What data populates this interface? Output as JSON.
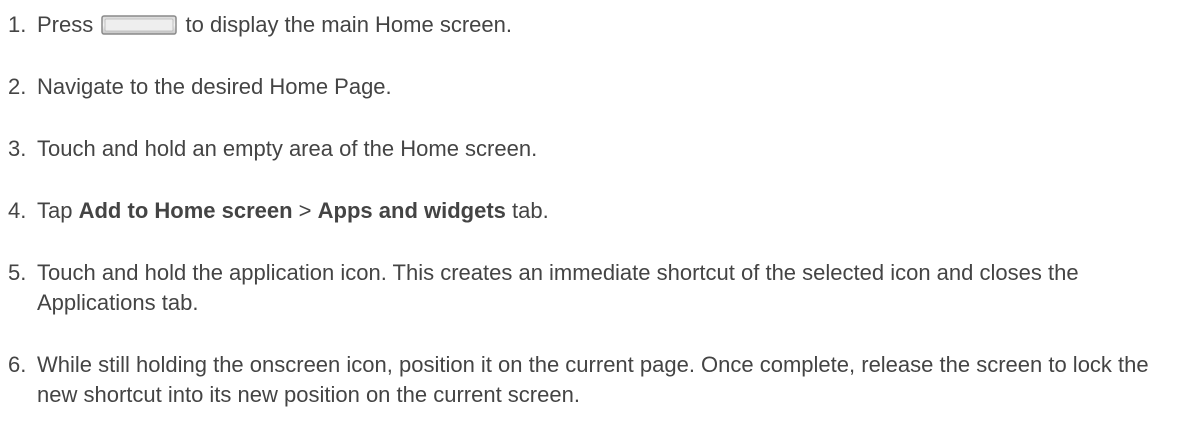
{
  "steps": [
    {
      "number": "1.",
      "before": "Press",
      "icon": "home-key-icon",
      "after": "to display the main Home screen."
    },
    {
      "number": "2.",
      "text": "Navigate to the desired Home Page."
    },
    {
      "number": "3.",
      "text": "Touch and hold an empty area of the Home screen."
    },
    {
      "number": "4.",
      "prefix": "Tap",
      "bold1": "Add to Home screen",
      "separator": ">",
      "bold2": "Apps and widgets",
      "suffix": "tab."
    },
    {
      "number": "5.",
      "text": "Touch and hold the application icon. This creates an immediate shortcut of the selected icon and closes the Applications tab."
    },
    {
      "number": "6.",
      "text": "While still holding the onscreen icon, position it on the current page. Once complete, release the screen to lock the new shortcut into its new position on the current screen."
    }
  ]
}
